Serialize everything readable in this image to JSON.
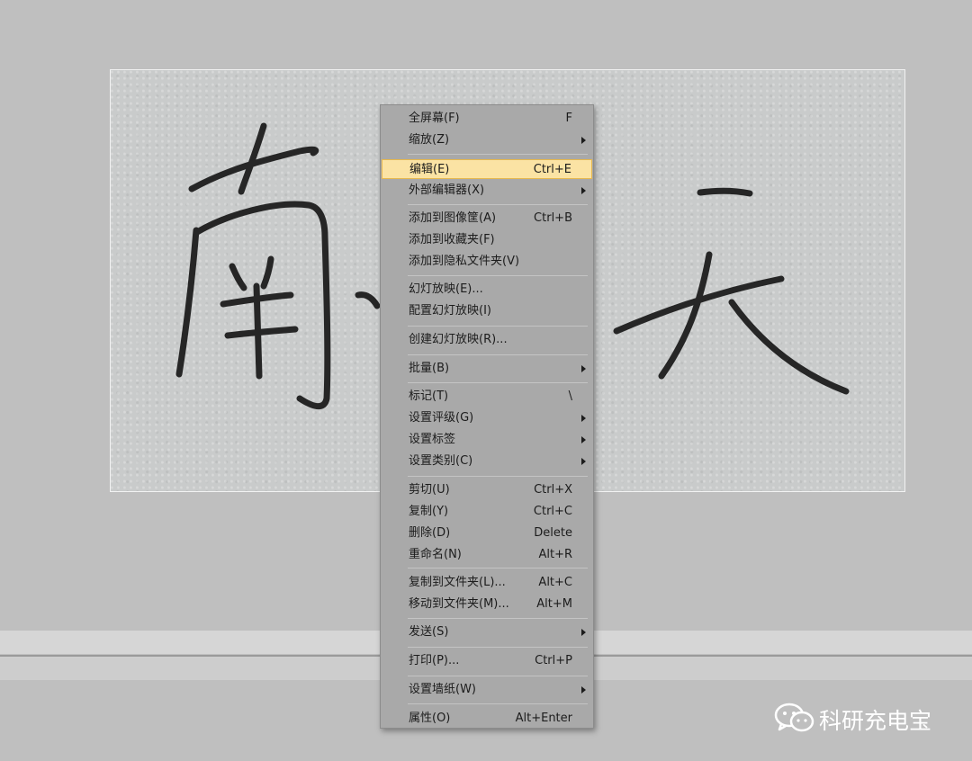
{
  "menu": {
    "items": [
      {
        "label": "全屏幕(F)",
        "shortcut": "F",
        "submenu": false
      },
      {
        "label": "缩放(Z)",
        "shortcut": "",
        "submenu": true
      },
      {
        "label": "编辑(E)",
        "shortcut": "Ctrl+E",
        "submenu": false,
        "highlighted": true
      },
      {
        "label": "外部编辑器(X)",
        "shortcut": "",
        "submenu": true
      },
      {
        "label": "添加到图像筐(A)",
        "shortcut": "Ctrl+B",
        "submenu": false
      },
      {
        "label": "添加到收藏夹(F)",
        "shortcut": "",
        "submenu": false
      },
      {
        "label": "添加到隐私文件夹(V)",
        "shortcut": "",
        "submenu": false
      },
      {
        "label": "幻灯放映(E)...",
        "shortcut": "",
        "submenu": false
      },
      {
        "label": "配置幻灯放映(I)",
        "shortcut": "",
        "submenu": false
      },
      {
        "label": "创建幻灯放映(R)...",
        "shortcut": "",
        "submenu": false
      },
      {
        "label": "批量(B)",
        "shortcut": "",
        "submenu": true
      },
      {
        "label": "标记(T)",
        "shortcut": "\\",
        "submenu": false
      },
      {
        "label": "设置评级(G)",
        "shortcut": "",
        "submenu": true
      },
      {
        "label": "设置标签",
        "shortcut": "",
        "submenu": true
      },
      {
        "label": "设置类别(C)",
        "shortcut": "",
        "submenu": true
      },
      {
        "label": "剪切(U)",
        "shortcut": "Ctrl+X",
        "submenu": false
      },
      {
        "label": "复制(Y)",
        "shortcut": "Ctrl+C",
        "submenu": false
      },
      {
        "label": "删除(D)",
        "shortcut": "Delete",
        "submenu": false
      },
      {
        "label": "重命名(N)",
        "shortcut": "Alt+R",
        "submenu": false
      },
      {
        "label": "复制到文件夹(L)...",
        "shortcut": "Alt+C",
        "submenu": false
      },
      {
        "label": "移动到文件夹(M)...",
        "shortcut": "Alt+M",
        "submenu": false
      },
      {
        "label": "发送(S)",
        "shortcut": "",
        "submenu": true
      },
      {
        "label": "打印(P)...",
        "shortcut": "Ctrl+P",
        "submenu": false
      },
      {
        "label": "设置墙纸(W)",
        "shortcut": "",
        "submenu": true
      },
      {
        "label": "属性(O)",
        "shortcut": "Alt+Enter",
        "submenu": false
      }
    ]
  },
  "watermark": {
    "text": "科研充电宝",
    "icon": "wechat-icon",
    "color": "#ffffff"
  },
  "colors": {
    "background": "#bfbfbf",
    "menu_background": "#a9a9a9",
    "highlight": "#fbe3a4",
    "highlight_border": "#e7b84d"
  }
}
